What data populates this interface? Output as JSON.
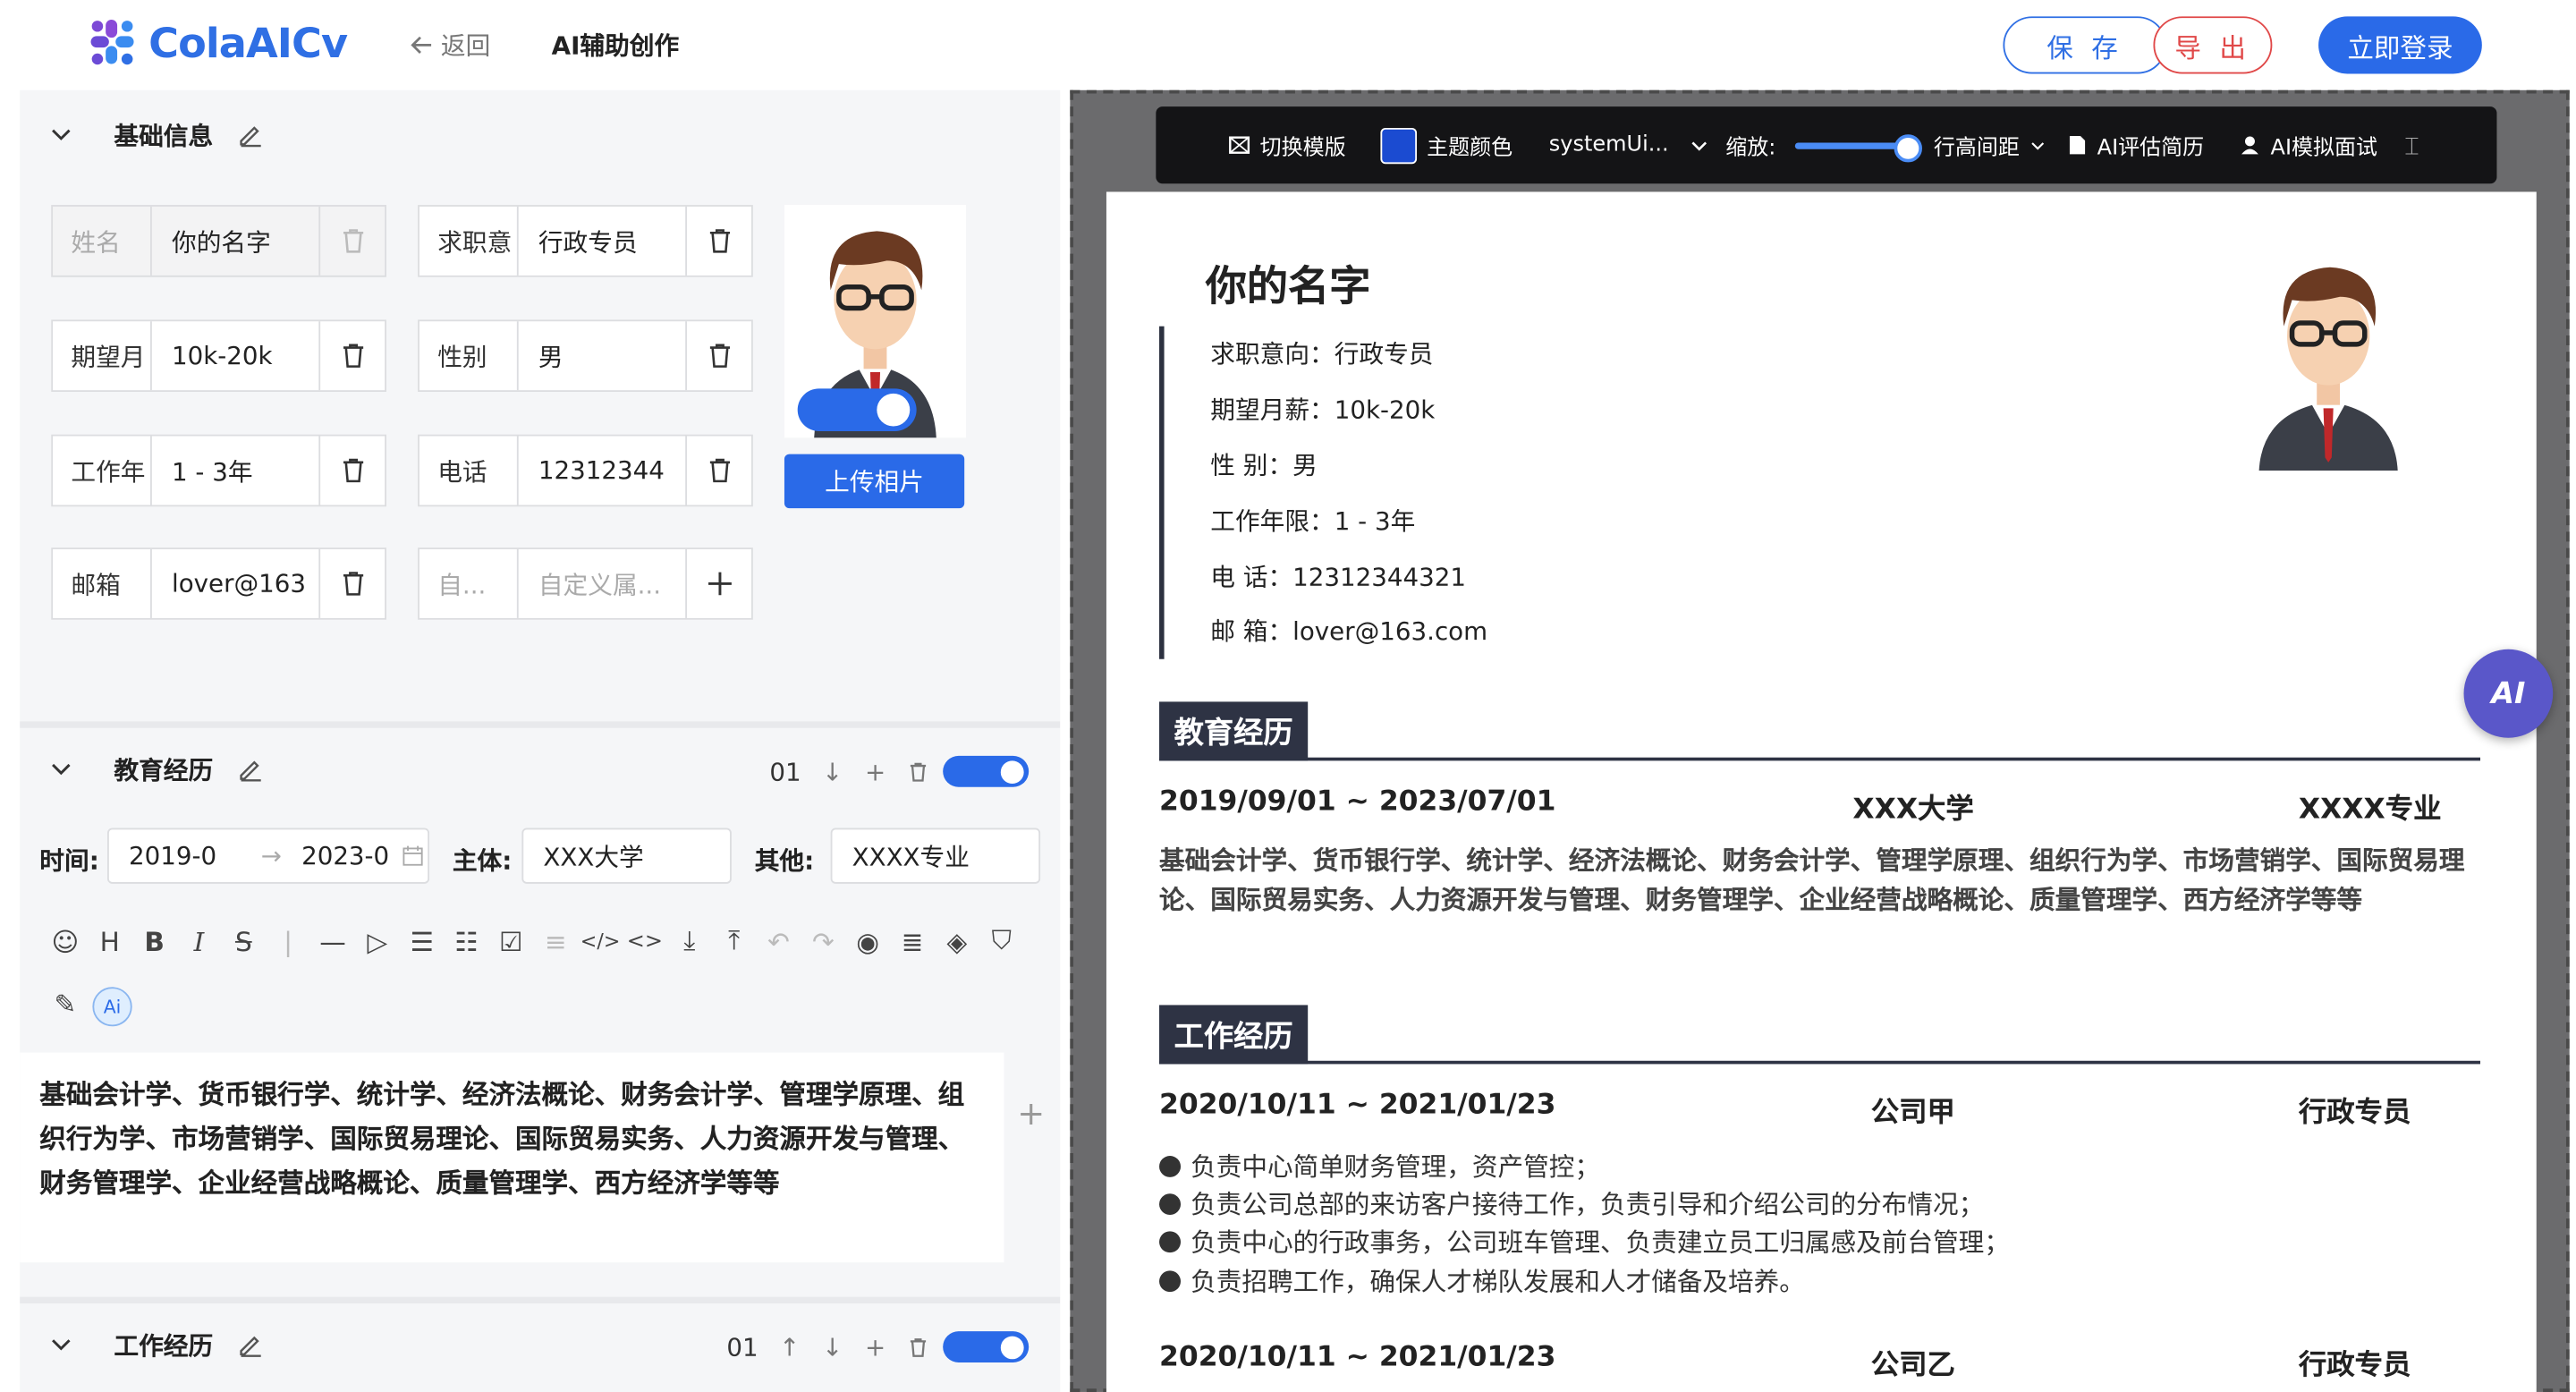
{
  "header": {
    "logo_text": "ColaAICv",
    "back_label": "返回",
    "mode_label": "AI辅助创作",
    "save_label": "保 存",
    "export_label": "导 出",
    "login_label": "立即登录"
  },
  "basic": {
    "title": "基础信息",
    "fields": [
      {
        "label": "姓名",
        "value": "你的名字"
      },
      {
        "label": "求职意",
        "value": "行政专员"
      },
      {
        "label": "期望月",
        "value": "10k-20k"
      },
      {
        "label": "性别",
        "value": "男"
      },
      {
        "label": "工作年",
        "value": "1 - 3年"
      },
      {
        "label": "电话",
        "value": "12312344"
      },
      {
        "label": "邮箱",
        "value": "lover@163"
      }
    ],
    "custom_label_placeholder": "自...",
    "custom_value_placeholder": "自定义属...",
    "photo_show": true,
    "upload_label": "上传相片"
  },
  "education": {
    "title": "教育经历",
    "index": "01",
    "enabled": true,
    "time_label": "时间:",
    "start": "2019-0",
    "end": "2023-0",
    "subject_label": "主体:",
    "subject": "XXX大学",
    "other_label": "其他:",
    "other": "XXXX专业",
    "editor_text": "基础会计学、货币银行学、统计学、经济法概论、财务会计学、管理学原理、组织行为学、市场营销学、国际贸易理论、国际贸易实务、人力资源开发与管理、财务管理学、企业经营战略概论、质量管理学、西方经济学等等",
    "ai_chip": "Ai"
  },
  "work": {
    "title": "工作经历",
    "index": "01",
    "enabled": true
  },
  "preview_toolbar": {
    "switch_template": "切换模版",
    "theme_color": "主题颜色",
    "theme_hex": "#1b4bd1",
    "font": "systemUi...",
    "zoom_label": "缩放:",
    "zoom_level": 1.0,
    "line_height": "行高间距",
    "ai_evaluate": "AI评估简历",
    "ai_interview": "AI模拟面试"
  },
  "resume": {
    "name": "你的名字",
    "info": [
      "求职意向：行政专员",
      "期望月薪：10k-20k",
      "性 别：男",
      "工作年限：1 - 3年",
      "电 话：12312344321",
      "邮 箱：lover@163.com"
    ],
    "edu_heading": "教育经历",
    "edu_date": "2019/09/01 ~ 2023/07/01",
    "edu_school": "XXX大学",
    "edu_major": "XXXX专业",
    "edu_desc": "基础会计学、货币银行学、统计学、经济法概论、财务会计学、管理学原理、组织行为学、市场营销学、国际贸易理论、国际贸易实务、人力资源开发与管理、财务管理学、企业经营战略概论、质量管理学、西方经济学等等",
    "work_heading": "工作经历",
    "work1_date": "2020/10/11 ~ 2021/01/23",
    "work1_company": "公司甲",
    "work1_role": "行政专员",
    "work1_bullets": [
      "负责中心简单财务管理，资产管控；",
      "负责公司总部的来访客户接待工作，负责引导和介绍公司的分布情况；",
      "负责中心的行政事务，公司班车管理、负责建立员工归属感及前台管理；",
      "负责招聘工作，确保人才梯队发展和人才储备及培养。"
    ],
    "work2_date": "2020/10/11 ~ 2021/01/23",
    "work2_company": "公司乙",
    "work2_role": "行政专员"
  },
  "ai_float": "AI"
}
